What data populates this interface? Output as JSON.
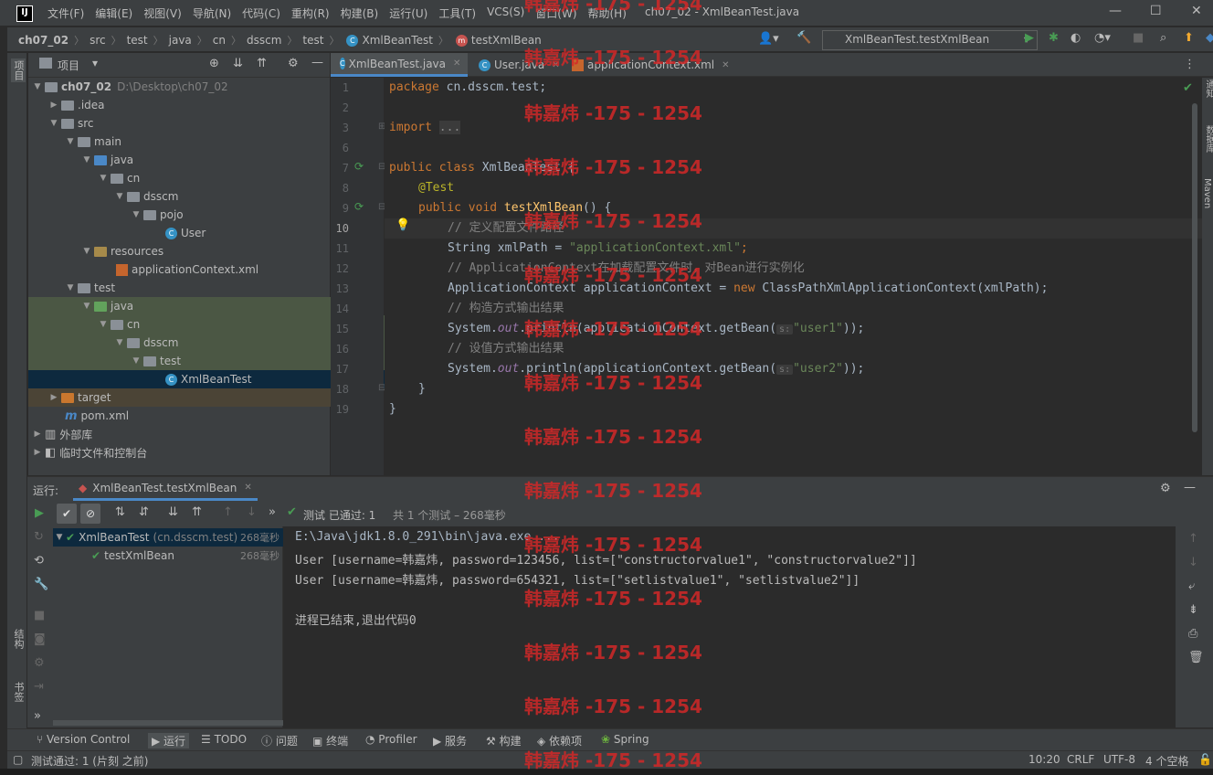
{
  "titlebar": {
    "logo": "IJ",
    "menus": [
      "文件(F)",
      "编辑(E)",
      "视图(V)",
      "导航(N)",
      "代码(C)",
      "重构(R)",
      "构建(B)",
      "运行(U)",
      "工具(T)",
      "VCS(S)",
      "窗口(W)",
      "帮助(H)"
    ],
    "window_title": "ch07_02 - XmlBeanTest.java"
  },
  "navbar": {
    "crumbs": [
      "ch07_02",
      "src",
      "test",
      "java",
      "cn",
      "dsscm",
      "test",
      "XmlBeanTest",
      "testXmlBean"
    ],
    "run_config": "XmlBeanTest.testXmlBean"
  },
  "left_strip": {
    "project": "项目",
    "structure": "结构",
    "bookmarks": "书签"
  },
  "right_strip": {
    "notifications": "通知",
    "database": "数据库",
    "maven": "Maven"
  },
  "project": {
    "header": "项目",
    "tree": [
      {
        "label": "ch07_02",
        "extra": "D:\\Desktop\\ch07_02",
        "icon": "folder"
      },
      {
        "label": ".idea",
        "icon": "folder"
      },
      {
        "label": "src",
        "icon": "folder"
      },
      {
        "label": "main",
        "icon": "folder"
      },
      {
        "label": "java",
        "icon": "folder-blue"
      },
      {
        "label": "cn",
        "icon": "package"
      },
      {
        "label": "dsscm",
        "icon": "package"
      },
      {
        "label": "pojo",
        "icon": "package"
      },
      {
        "label": "User",
        "icon": "class"
      },
      {
        "label": "resources",
        "icon": "folder-res"
      },
      {
        "label": "applicationContext.xml",
        "icon": "xml"
      },
      {
        "label": "test",
        "icon": "folder"
      },
      {
        "label": "java",
        "icon": "folder-green"
      },
      {
        "label": "cn",
        "icon": "package"
      },
      {
        "label": "dsscm",
        "icon": "package"
      },
      {
        "label": "test",
        "icon": "package"
      },
      {
        "label": "XmlBeanTest",
        "icon": "class"
      },
      {
        "label": "target",
        "icon": "folder-orange"
      },
      {
        "label": "pom.xml",
        "icon": "maven"
      },
      {
        "label": "外部库",
        "icon": "library"
      },
      {
        "label": "临时文件和控制台",
        "icon": "scratch"
      }
    ]
  },
  "editor": {
    "tabs": [
      "XmlBeanTest.java",
      "User.java",
      "applicationContext.xml"
    ],
    "line_numbers": [
      "1",
      "2",
      "3",
      "6",
      "7",
      "8",
      "9",
      "10",
      "11",
      "12",
      "13",
      "14",
      "15",
      "16",
      "17",
      "18",
      "19"
    ],
    "code": {
      "l1_kw": "package",
      "l1_rest": " cn.dsscm.test;",
      "l3_kw": "import",
      "l3_fold": "...",
      "l7_kw": "public class",
      "l7_rest": " XmlBeanTest {",
      "l8_ann": "@Test",
      "l9_kw": "public void",
      "l9_fn": "testXmlBean",
      "l9_rest": "() {",
      "l10_cmt": "// 定义配置文件路径",
      "l11_type": "String xmlPath = ",
      "l11_str": "\"applicationContext.xml\"",
      "l11_end": ";",
      "l12_cmt": "// ApplicationContext在加载配置文件时，对Bean进行实例化",
      "l13_a": "ApplicationContext applicationContext = ",
      "l13_kw": "new",
      "l13_b": " ClassPathXmlApplicationContext(xmlPath);",
      "l14_cmt": "// 构造方式输出结果",
      "l15_a": "System.",
      "l15_out": "out",
      "l15_b": ".println(applicationContext.getBean(",
      "l15_hint": "s:",
      "l15_str": "\"user1\"",
      "l15_end": "));",
      "l16_cmt": "// 设值方式输出结果",
      "l17_a": "System.",
      "l17_out": "out",
      "l17_b": ".println(applicationContext.getBean(",
      "l17_hint": "s:",
      "l17_str": "\"user2\"",
      "l17_end": "));",
      "l18": "}",
      "l19": "}"
    }
  },
  "run": {
    "label": "运行:",
    "tab": "XmlBeanTest.testXmlBean",
    "status_prefix": "测试 已通过: 1",
    "status_suffix": "共 1 个测试 – 268毫秒",
    "tree": [
      {
        "label": "XmlBeanTest",
        "extra": "(cn.dsscm.test)",
        "time": "268毫秒"
      },
      {
        "label": "testXmlBean",
        "time": "268毫秒"
      }
    ],
    "console": [
      "E:\\Java\\jdk1.8.0_291\\bin\\java.exe ...",
      "User [username=韩嘉炜, password=123456, list=[\"constructorvalue1\", \"constructorvalue2\"]]",
      "User [username=韩嘉炜, password=654321, list=[\"setlistvalue1\", \"setlistvalue2\"]]",
      "",
      "进程已结束,退出代码0"
    ]
  },
  "tool_windows": [
    "Version Control",
    "运行",
    "TODO",
    "问题",
    "终端",
    "Profiler",
    "服务",
    "构建",
    "依赖项",
    "Spring"
  ],
  "status": {
    "message": "测试通过: 1 (片刻 之前)",
    "position": "10:20",
    "line_sep": "CRLF",
    "encoding": "UTF-8",
    "indent": "4 个空格"
  },
  "watermark": "韩嘉炜 -175 - 1254",
  "colors": {
    "accent": "#4a88c7",
    "pass": "#499c54",
    "watermark": "#d22828"
  }
}
